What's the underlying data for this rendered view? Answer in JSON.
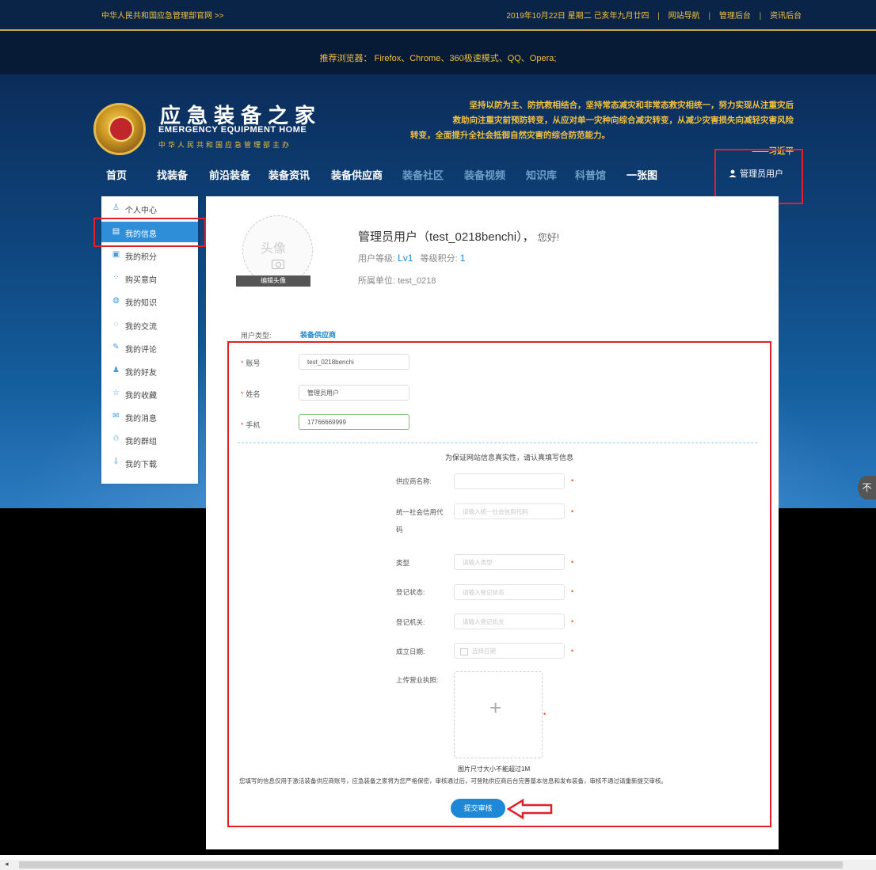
{
  "topbar": {
    "left_link": "中华人民共和国应急管理部官网  >>",
    "date": "2019年10月22日 星期二 己亥年九月廿四",
    "links": [
      "网站导航",
      "管理后台",
      "资讯后台"
    ]
  },
  "browser_note": "推荐浏览器： Firefox、Chrome、360极速模式、QQ、Opera;",
  "logo": {
    "title": "应急装备之家",
    "en": "EMERGENCY EQUIPMENT HOME",
    "cn": "中华人民共和国应急管理部主办"
  },
  "slogan": {
    "line1": "坚持以防为主、防抗救相结合，坚持常态减灾和非常态救灾相统一，努力实现从注重灾后",
    "line2": "救助向注重灾前预防转变，从应对单一灾种向综合减灾转变，从减少灾害损失向减轻灾害风险",
    "line3": "转变，全面提升全社会抵御自然灾害的综合防范能力。",
    "author": "——习近平"
  },
  "nav": {
    "items": [
      "首页",
      "找装备",
      "前沿装备",
      "装备资讯",
      "装备供应商",
      "装备社区",
      "装备视频",
      "知识库",
      "科普馆",
      "一张图"
    ],
    "user": "管理员用户"
  },
  "sidebar": {
    "items": [
      {
        "label": "个人中心",
        "icon": "person-icon"
      },
      {
        "label": "我的信息",
        "icon": "id-card-icon"
      },
      {
        "label": "我的积分",
        "icon": "points-icon"
      },
      {
        "label": "购买意向",
        "icon": "grid-icon"
      },
      {
        "label": "我的知识",
        "icon": "knowledge-icon"
      },
      {
        "label": "我的交流",
        "icon": "chat-icon"
      },
      {
        "label": "我的评论",
        "icon": "pen-icon"
      },
      {
        "label": "我的好友",
        "icon": "friend-icon"
      },
      {
        "label": "我的收藏",
        "icon": "star-icon"
      },
      {
        "label": "我的消息",
        "icon": "mail-icon"
      },
      {
        "label": "我的群组",
        "icon": "group-icon"
      },
      {
        "label": "我的下载",
        "icon": "download-icon"
      }
    ],
    "active_index": 1
  },
  "profile": {
    "avatar_label": "头像",
    "edit_avatar": "编辑头像",
    "greeting_name": "管理员用户（test_0218benchi），",
    "greeting_hello": "您好!",
    "level_label": "用户等级:",
    "level_value": "Lv1",
    "points_label": "等级积分:",
    "points_value": "1",
    "unit_label": "所属单位:",
    "unit_value": "test_0218"
  },
  "user_type": {
    "label": "用户类型:",
    "value": "装备供应商"
  },
  "account_fields": [
    {
      "label": "账号",
      "value": "test_0218benchi"
    },
    {
      "label": "姓名",
      "value": "管理员用户"
    },
    {
      "label": "手机",
      "value": "17766669999"
    }
  ],
  "supplier_notice": "为保证网站信息真实性，请认真填写信息",
  "supplier_fields": [
    {
      "label": "供应商名称:",
      "placeholder": ""
    },
    {
      "label": "统一社会信用代",
      "label2": "码",
      "placeholder": "请输入统一社会信用代码"
    },
    {
      "label": "类型",
      "placeholder": "请输入类型"
    },
    {
      "label": "登记状态:",
      "placeholder": "请输入登记状态"
    },
    {
      "label": "登记机关:",
      "placeholder": "请输入登记机关"
    },
    {
      "label": "成立日期:",
      "placeholder": "选择日期"
    }
  ],
  "upload": {
    "label": "上传营业执照:",
    "size_note": "图片尺寸大小不能超过1M"
  },
  "disclaimer": "您填写的信息仅用于激活装备供应商账号，应急装备之家将为您严格保密，审核通过后，可登陆供应商后台完善基本信息和发布装备，审核不通过请重新提交审核。",
  "submit_label": "提交审核",
  "colors": {
    "accent": "#1e88d6",
    "gold": "#f0c040",
    "highlight": "#e0202a"
  }
}
